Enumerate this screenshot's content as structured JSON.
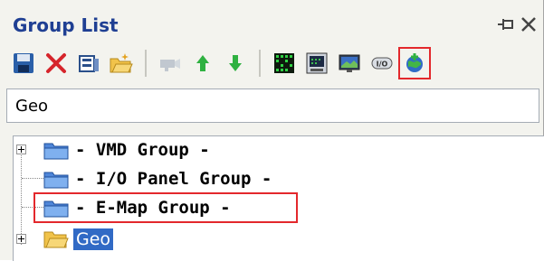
{
  "panel": {
    "title": "Group List"
  },
  "search": {
    "value": "Geo"
  },
  "tree": {
    "items": [
      {
        "label": "- VMD Group -",
        "expandable": true
      },
      {
        "label": "- I/O Panel Group -",
        "expandable": false
      },
      {
        "label": "- E-Map Group -",
        "expandable": false,
        "highlighted": true
      },
      {
        "label": "Geo",
        "expandable": true,
        "selected": true
      }
    ]
  },
  "colors": {
    "title": "#1f3f93",
    "selection": "#316ac5",
    "highlight": "#e3282c",
    "folder_blue": "#4f86d8",
    "folder_yellow": "#f1c34a"
  },
  "icons": {
    "toolbar": [
      "save-icon",
      "delete-icon",
      "properties-icon",
      "open-folder-icon",
      "camera-icon",
      "move-up-icon",
      "move-down-icon",
      "vmd-icon",
      "io-panel-icon",
      "emap-icon",
      "io-icon",
      "add-geo-icon"
    ],
    "window": [
      "pin-icon",
      "close-icon"
    ]
  }
}
